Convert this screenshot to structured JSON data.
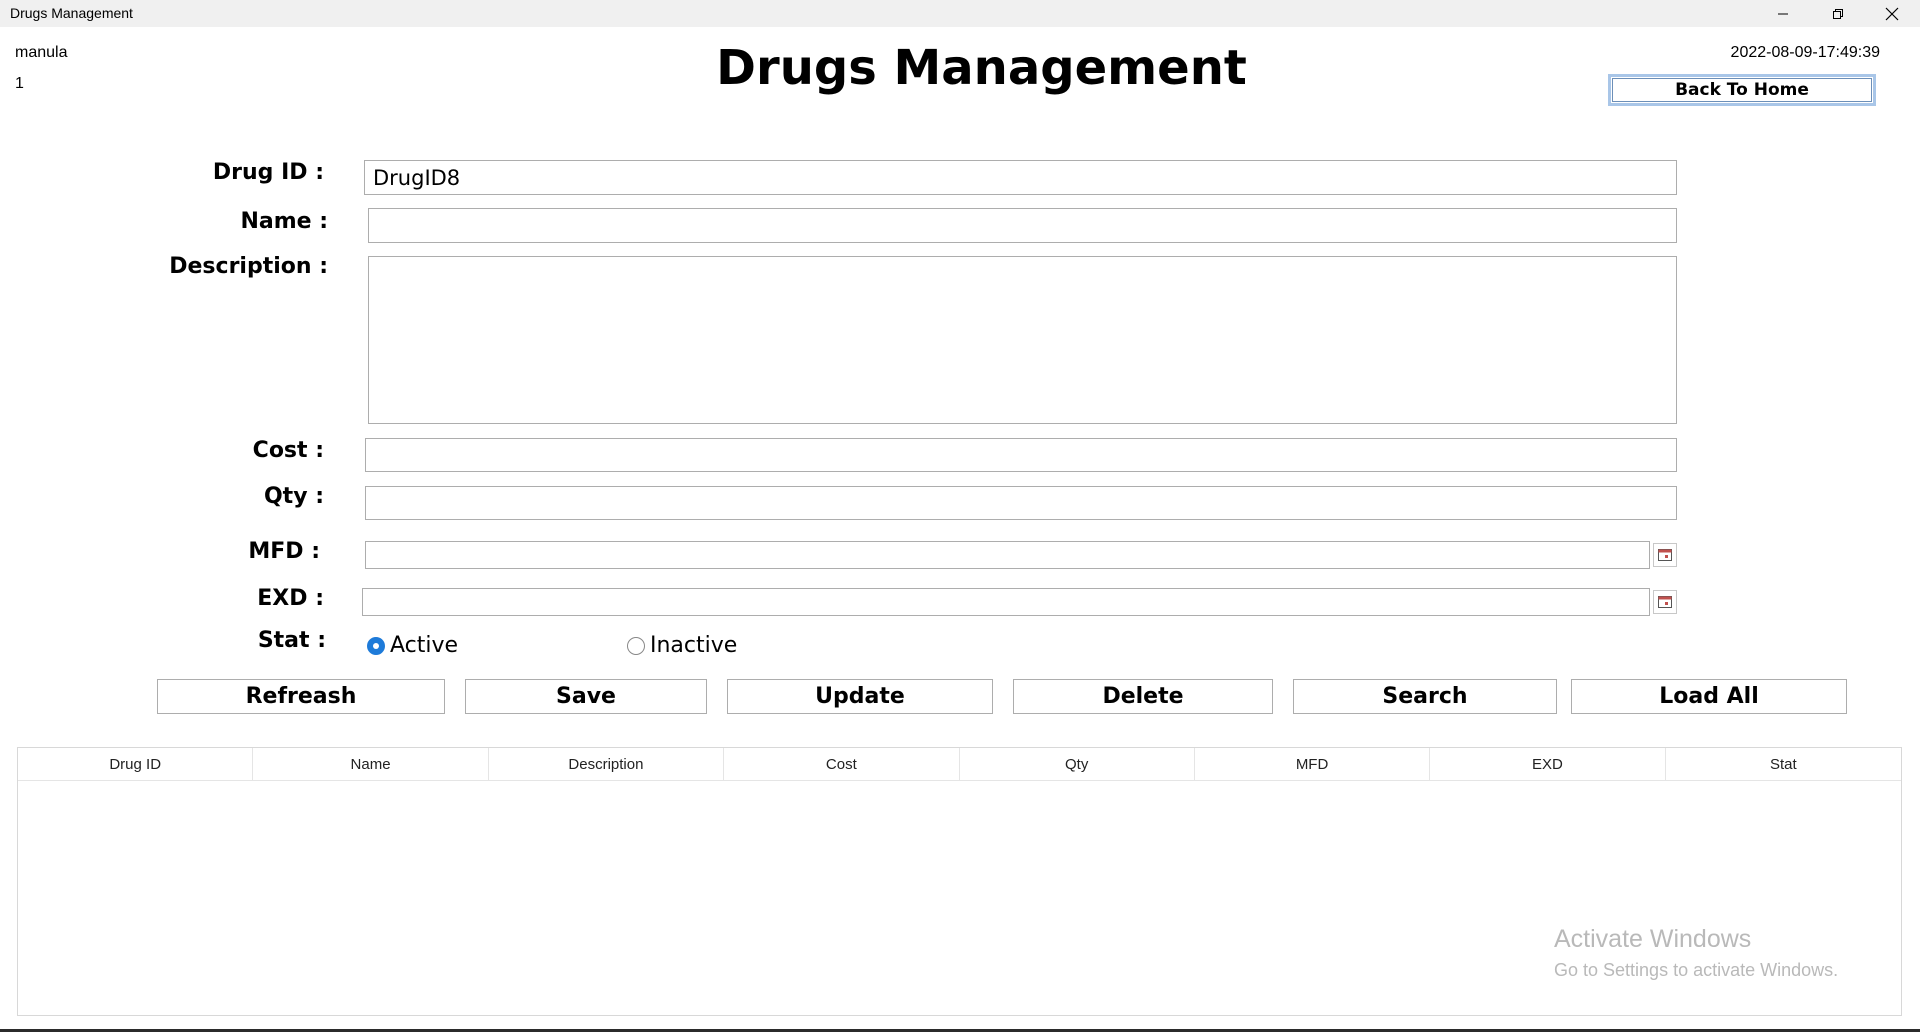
{
  "window": {
    "title": "Drugs Management",
    "controls": [
      "minimize-icon",
      "restore-icon",
      "close-icon"
    ]
  },
  "header": {
    "user_name": "manula",
    "user_id": "1",
    "page_title": "Drugs Management",
    "datetime": "2022-08-09-17:49:39",
    "back_home_label": "Back To Home"
  },
  "form": {
    "drug_id": {
      "label": "Drug ID :",
      "value": "DrugID8"
    },
    "name": {
      "label": "Name :",
      "value": ""
    },
    "description": {
      "label": "Description :",
      "value": ""
    },
    "cost": {
      "label": "Cost :",
      "value": ""
    },
    "qty": {
      "label": "Qty :",
      "value": ""
    },
    "mfd": {
      "label": "MFD :",
      "value": ""
    },
    "exd": {
      "label": "EXD :",
      "value": ""
    },
    "stat": {
      "label": "Stat :",
      "options": [
        {
          "label": "Active",
          "selected": true
        },
        {
          "label": "Inactive",
          "selected": false
        }
      ]
    }
  },
  "actions": {
    "refresh": "Refreash",
    "save": "Save",
    "update": "Update",
    "delete": "Delete",
    "search": "Search",
    "load_all": "Load All"
  },
  "table": {
    "columns": [
      "Drug ID",
      "Name",
      "Description",
      "Cost",
      "Qty",
      "MFD",
      "EXD",
      "Stat"
    ],
    "rows": []
  },
  "watermark": {
    "line1": "Activate Windows",
    "line2": "Go to Settings to activate Windows."
  },
  "colors": {
    "accent": "#1e7bd9",
    "titlebar": "#f0f0f0",
    "watermark": "#b9b9b9"
  }
}
